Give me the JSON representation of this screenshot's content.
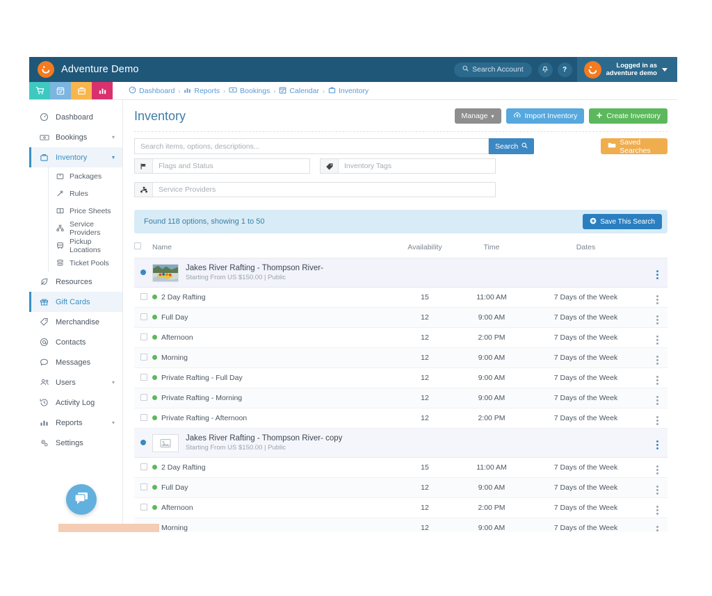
{
  "topbar": {
    "brand_name": "Adventure Demo",
    "search_account_label": "Search Account",
    "search_icon": "search-icon",
    "bell_icon": "bell-icon",
    "help_label": "?",
    "logged_in_as_label": "Logged in as",
    "account_name": "adventure demo",
    "brand_color": "#f47b20",
    "bar_color": "#1f5779"
  },
  "quick_icons": [
    {
      "name": "cart-icon",
      "color": "#3ec9c0"
    },
    {
      "name": "calendar-check-icon",
      "color": "#7cb5e0"
    },
    {
      "name": "briefcase-icon",
      "color": "#f9b councils",
      "color2": "#f9b54c"
    },
    {
      "name": "bar-chart-icon",
      "color": "#d8316e"
    }
  ],
  "breadcrumb": [
    {
      "label": "Dashboard",
      "icon": "speedometer-icon"
    },
    {
      "label": "Reports",
      "icon": "bar-chart-icon"
    },
    {
      "label": "Bookings",
      "icon": "ticket-icon"
    },
    {
      "label": "Calendar",
      "icon": "calendar-icon"
    },
    {
      "label": "Inventory",
      "icon": "briefcase-icon"
    }
  ],
  "sidebar": {
    "items": [
      {
        "label": "Dashboard",
        "icon": "speedometer-icon",
        "active": false,
        "expandable": false
      },
      {
        "label": "Bookings",
        "icon": "ticket-icon",
        "active": false,
        "expandable": true
      },
      {
        "label": "Inventory",
        "icon": "briefcase-icon",
        "active": true,
        "expandable": true
      },
      {
        "label": "Resources",
        "icon": "leaf-icon",
        "active": false,
        "expandable": false
      },
      {
        "label": "Gift Cards",
        "icon": "gift-icon",
        "active": true,
        "expandable": false
      },
      {
        "label": "Merchandise",
        "icon": "tag-icon",
        "active": false,
        "expandable": false
      },
      {
        "label": "Contacts",
        "icon": "at-icon",
        "active": false,
        "expandable": false
      },
      {
        "label": "Messages",
        "icon": "chat-icon",
        "active": false,
        "expandable": false
      },
      {
        "label": "Users",
        "icon": "users-icon",
        "active": false,
        "expandable": true
      },
      {
        "label": "Activity Log",
        "icon": "history-icon",
        "active": false,
        "expandable": false
      },
      {
        "label": "Reports",
        "icon": "bar-chart-icon",
        "active": false,
        "expandable": true
      },
      {
        "label": "Settings",
        "icon": "gears-icon",
        "active": false,
        "expandable": false
      }
    ],
    "inventory_sub_items": [
      {
        "label": "Packages",
        "icon": "box-icon"
      },
      {
        "label": "Rules",
        "icon": "gavel-icon"
      },
      {
        "label": "Price Sheets",
        "icon": "columns-icon"
      },
      {
        "label": "Service Providers",
        "icon": "sitemap-icon"
      },
      {
        "label": "Pickup Locations",
        "icon": "bus-icon"
      },
      {
        "label": "Ticket Pools",
        "icon": "layers-icon"
      }
    ]
  },
  "page": {
    "title": "Inventory",
    "actions": [
      {
        "label": "Manage",
        "icon": "caret-down-icon",
        "color": "#8e8e8e",
        "name": "manage-button"
      },
      {
        "label": "Import Inventory",
        "icon": "cloud-upload-icon",
        "color": "#56a8de",
        "name": "import-inventory-button"
      },
      {
        "label": "Create Inventory",
        "icon": "plus-icon",
        "color": "#5cb85c",
        "name": "create-inventory-button"
      }
    ]
  },
  "search": {
    "placeholder": "Search items, options, descriptions...",
    "value": "",
    "search_button_label": "Search",
    "saved_searches_label": "Saved Searches",
    "filters": [
      {
        "placeholder": "Flags and Status",
        "icon": "flag-icon",
        "name": "flags-and-status-filter"
      },
      {
        "placeholder": "Inventory Tags",
        "icon": "tag-icon",
        "name": "inventory-tags-filter"
      },
      {
        "placeholder": "Service Providers",
        "icon": "sitemap-icon",
        "name": "service-providers-filter"
      }
    ]
  },
  "results": {
    "summary": "Found 118 options, showing 1 to 50",
    "save_this_search_label": "Save This Search"
  },
  "table": {
    "columns": [
      "Name",
      "Availability",
      "Time",
      "Dates"
    ],
    "groups": [
      {
        "title": "Jakes River Rafting - Thompson River-",
        "subtitle": "Starting From US $150.00 | Public",
        "thumb": "photo-thumbnail",
        "rows": [
          {
            "name": "2 Day Rafting",
            "availability": "15",
            "time": "11:00 AM",
            "dates": "7 Days of the Week"
          },
          {
            "name": "Full Day",
            "availability": "12",
            "time": "9:00 AM",
            "dates": "7 Days of the Week"
          },
          {
            "name": "Afternoon",
            "availability": "12",
            "time": "2:00 PM",
            "dates": "7 Days of the Week"
          },
          {
            "name": "Morning",
            "availability": "12",
            "time": "9:00 AM",
            "dates": "7 Days of the Week"
          },
          {
            "name": "Private Rafting - Full Day",
            "availability": "12",
            "time": "9:00 AM",
            "dates": "7 Days of the Week"
          },
          {
            "name": "Private Rafting - Morning",
            "availability": "12",
            "time": "9:00 AM",
            "dates": "7 Days of the Week"
          },
          {
            "name": "Private Rafting - Afternoon",
            "availability": "12",
            "time": "2:00 PM",
            "dates": "7 Days of the Week"
          }
        ]
      },
      {
        "title": "Jakes River Rafting - Thompson River- copy",
        "subtitle": "Starting From US $150.00 | Public",
        "thumb": "image-placeholder",
        "rows": [
          {
            "name": "2 Day Rafting",
            "availability": "15",
            "time": "11:00 AM",
            "dates": "7 Days of the Week"
          },
          {
            "name": "Full Day",
            "availability": "12",
            "time": "9:00 AM",
            "dates": "7 Days of the Week"
          },
          {
            "name": "Afternoon",
            "availability": "12",
            "time": "2:00 PM",
            "dates": "7 Days of the Week"
          },
          {
            "name": "Morning",
            "availability": "12",
            "time": "9:00 AM",
            "dates": "7 Days of the Week"
          }
        ]
      }
    ]
  },
  "chat_widget": {
    "icon": "chat-bubbles-icon",
    "color": "#62b0dd"
  }
}
